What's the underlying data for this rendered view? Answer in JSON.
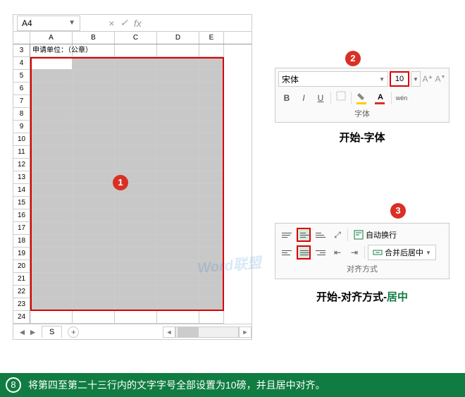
{
  "namebox": {
    "value": "A4"
  },
  "formula": {
    "cancel": "×",
    "ok": "✓",
    "fx": "fx"
  },
  "columns": [
    "A",
    "B",
    "C",
    "D",
    "E"
  ],
  "row3_text": "申请单位：（公章）",
  "row_start": 3,
  "row_end": 24,
  "sel_start": 4,
  "sel_end": 23,
  "sheet": {
    "name": "S",
    "add": "+"
  },
  "watermark": "Word联盟",
  "badges": {
    "b1": "1",
    "b2": "2",
    "b3": "3"
  },
  "font": {
    "name": "宋体",
    "size": "10",
    "bold": "B",
    "italic": "I",
    "underline": "U",
    "group_label": "字体",
    "section_title": "开始-字体"
  },
  "align": {
    "wrap_label": "自动换行",
    "merge_label": "合并后居中",
    "group_label": "对齐方式",
    "title_prefix": "开始-对齐方式-",
    "title_suffix": "居中"
  },
  "footer": {
    "num": "8",
    "text": "将第四至第二十三行内的文字字号全部设置为10磅，并且居中对齐。"
  },
  "colors": {
    "fill": "#ffcc00",
    "fontcolor": "#d93025",
    "red": "#d93025",
    "green": "#107c41"
  }
}
